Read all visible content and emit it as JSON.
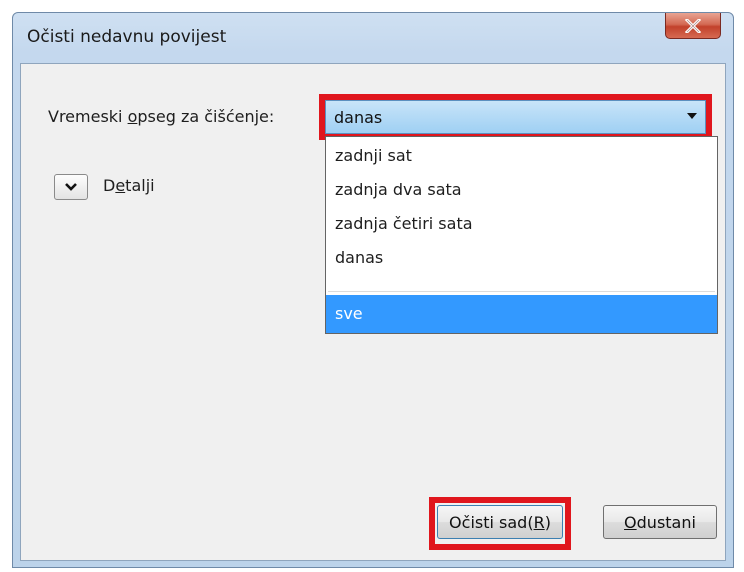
{
  "window": {
    "title": "Očisti nedavnu povijest",
    "close_icon": "close-x-icon"
  },
  "time_range": {
    "label_before": "Vremeski ",
    "label_accel": "o",
    "label_after": "pseg za čišćenje:",
    "selected_value": "danas",
    "options": [
      "zadnji sat",
      "zadnja dva sata",
      "zadnja četiri sata",
      "danas",
      "sve"
    ],
    "highlighted_option": "sve"
  },
  "details": {
    "label_before": "D",
    "label_accel": "e",
    "label_after": "talji",
    "icon": "chevron-down-icon"
  },
  "buttons": {
    "clear_label": "Očisti sad(",
    "clear_accel": "R",
    "clear_label_end": ")",
    "cancel_accel": "O",
    "cancel_label_after": "dustani"
  },
  "colors": {
    "highlight_box": "#e0161d",
    "selected_option_bg": "#3399ff",
    "title_bar": "#c4d8ee"
  }
}
